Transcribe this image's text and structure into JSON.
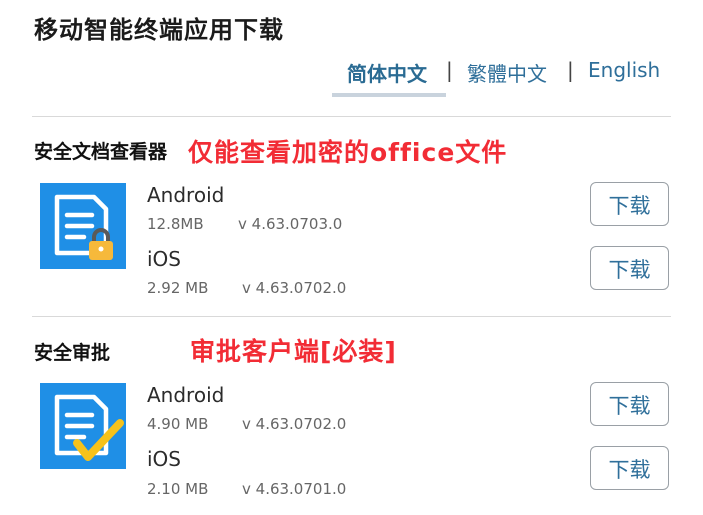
{
  "page": {
    "title": "移动智能终端应用下载"
  },
  "languages": [
    {
      "label": "简体中文",
      "active": true
    },
    {
      "label": "繁體中文",
      "active": false
    },
    {
      "label": "English",
      "active": false
    }
  ],
  "lang_separator": "|",
  "sections": [
    {
      "name": "安全文档查看器",
      "annotation": "仅能查看加密的office文件",
      "icon": "secure-document-lock-icon",
      "platforms": [
        {
          "os": "Android",
          "size": "12.8MB",
          "version": "v 4.63.0703.0",
          "button": "下载"
        },
        {
          "os": "iOS",
          "size": "2.92 MB",
          "version": "v 4.63.0702.0",
          "button": "下载"
        }
      ]
    },
    {
      "name": "安全审批",
      "annotation": "审批客户端[必装]",
      "icon": "approval-document-check-icon",
      "platforms": [
        {
          "os": "Android",
          "size": "4.90 MB",
          "version": "v 4.63.0702.0",
          "button": "下载"
        },
        {
          "os": "iOS",
          "size": "2.10 MB",
          "version": "v 4.63.0701.0",
          "button": "下载"
        }
      ]
    }
  ],
  "colors": {
    "accent": "#2f6f9a",
    "annotation": "#f22c35",
    "icon_bg": "#1f8fe6"
  }
}
